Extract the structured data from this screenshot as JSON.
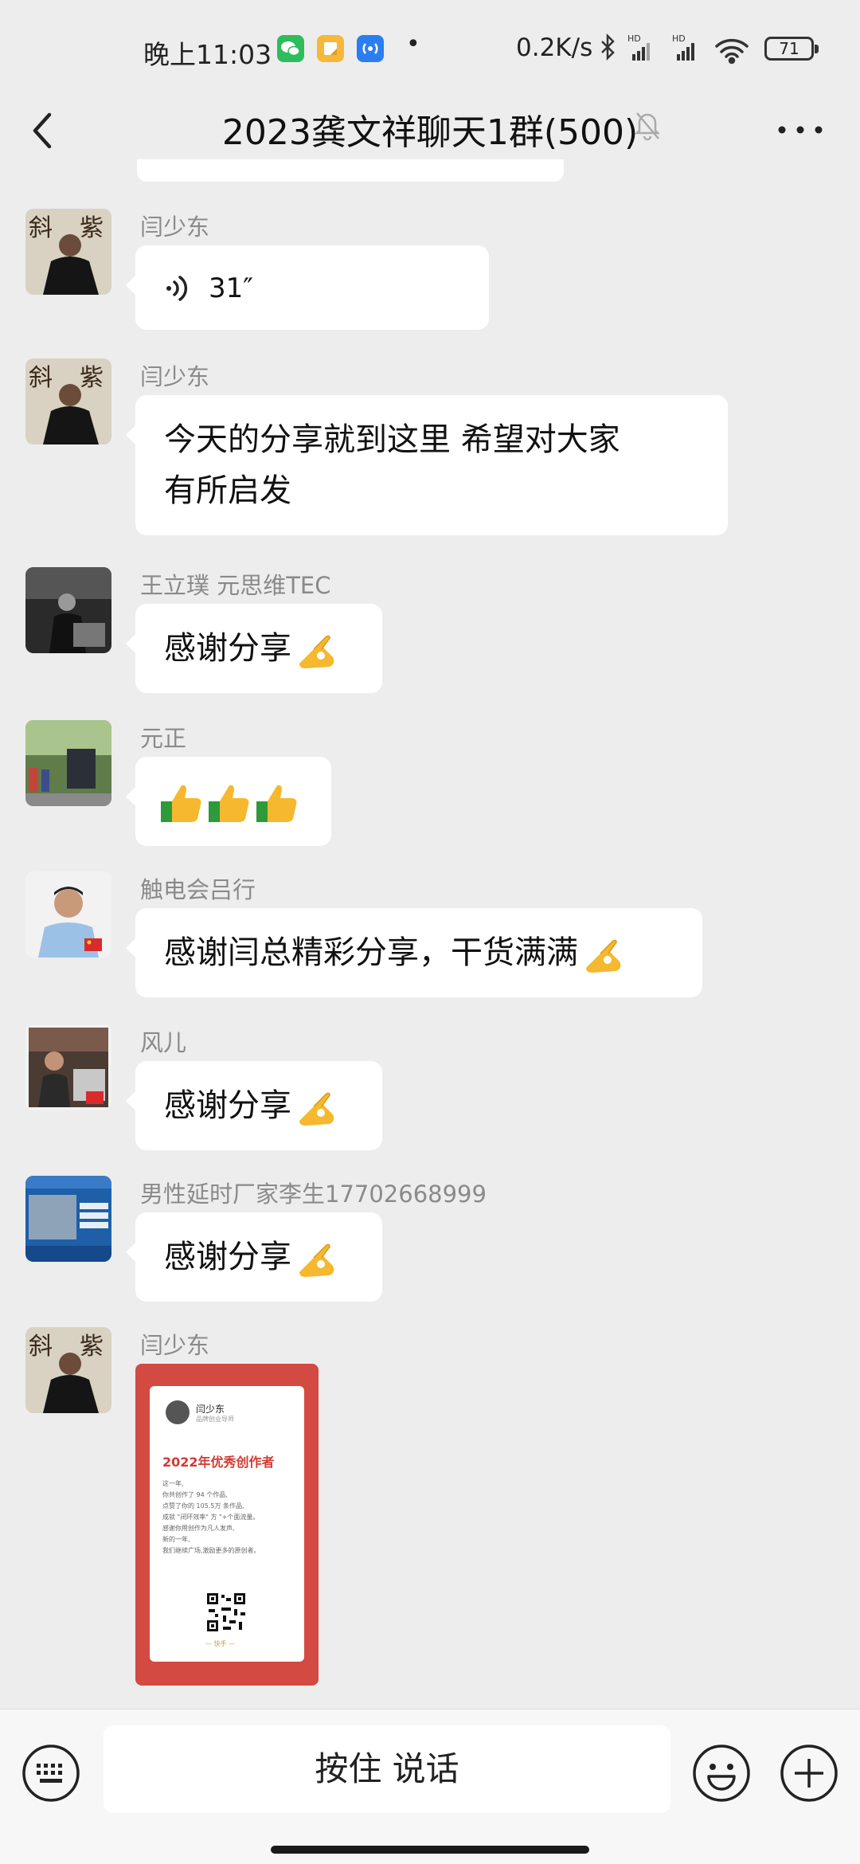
{
  "status_bar": {
    "time": "晚上11:03",
    "dot": "•",
    "net_speed": "0.2K/s",
    "battery": "71",
    "app_icons": [
      "wechat-icon",
      "notes-icon",
      "hotspot-icon"
    ]
  },
  "header": {
    "title": "2023龚文祥聊天1群(500)",
    "icons": [
      "back-icon",
      "mute-bell-icon",
      "more-icon"
    ]
  },
  "messages": [
    {
      "sender": "闫少东",
      "type": "voice",
      "duration": "31″"
    },
    {
      "sender": "闫少东",
      "type": "text",
      "lines": [
        "今天的分享就到这里 希望对大家",
        "有所启发"
      ]
    },
    {
      "sender": "王立璞   元思维TEC",
      "type": "text",
      "text": "感谢分享",
      "emoji": "ok-hand-emoji"
    },
    {
      "sender": "元正",
      "type": "emoji",
      "emoji": "thumbs-up-emoji ×3"
    },
    {
      "sender": "触电会吕行",
      "type": "text",
      "text": "感谢闫总精彩分享，干货满满",
      "emoji": "ok-hand-emoji"
    },
    {
      "sender": "风儿",
      "type": "text",
      "text": "感谢分享",
      "emoji": "ok-hand-emoji"
    },
    {
      "sender": "男性延时厂家李生17702668999",
      "type": "text",
      "text": "感谢分享",
      "emoji": "ok-hand-emoji"
    },
    {
      "sender": "闫少东",
      "type": "image",
      "card": {
        "author": "闫少东",
        "author_sub": "品牌创业导师",
        "title": "2022年优秀创作者",
        "lines": [
          "这一年,",
          "你共创作了 94 个作品,",
          "点赞了你的 105.5万 条作品,",
          "成就 \"闭环效率\" 方 \"+个面流量。",
          "感谢你用创作为凡人发声,",
          "新的一年,",
          "我们继续广场,激励更多的原创者。"
        ],
        "footer": "— 快手 —"
      }
    }
  ],
  "input_bar": {
    "hold_to_talk": "按住 说话",
    "icons": [
      "keyboard-icon",
      "emoji-icon",
      "plus-icon"
    ]
  },
  "colors": {
    "background": "#ededed",
    "bubble": "#ffffff",
    "sender_name": "#8a8a8a",
    "card_red": "#d24a41"
  }
}
